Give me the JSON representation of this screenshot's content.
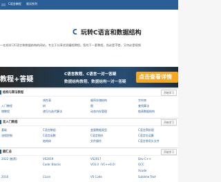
{
  "nav": {
    "items": [
      "",
      "C语言教程",
      "就试系列"
    ]
  },
  "hero": {
    "title": "玩转C语言和数据结构",
    "description": "一在线学习C语言和数据结构的网站，专注于分享优质编程教程。您的下一套教程，尚必是不错，又何必是视频"
  },
  "banner": {
    "left": "教程+答疑",
    "line1": "C语言教程、C语言一对一答疑",
    "line2": "数据结构教程、数据结构一对一答疑",
    "cta": "点击查看详情"
  },
  "sections": [
    {
      "title": "结构与算法教程",
      "more": "开始学习",
      "cols": [
        [
          "",
          "入门教程",
          "储教程"
        ],
        [
          "线性表",
          "树",
          "递归与迭代算法"
        ],
        [
          "顺序存储结构",
          "图",
          "动态内存管理"
        ],
        [
          "字符串",
          "查找算法",
          "链表数据结构"
        ]
      ]
    },
    {
      "title": "言入门教程",
      "more": "开始学习",
      "cols": [
        [
          "基础",
          "流程控制",
          ""
        ],
        [
          "C语言数组",
          "C语言函数",
          "结构体"
        ],
        [
          "变量数据类型",
          "C语言指针",
          "文件操作"
        ],
        [
          "C语言预处理",
          "C语言位运算",
          "C语言常用头文件"
        ]
      ]
    },
    {
      "title": "器汇总",
      "more": "开始学习",
      "cols": [
        [
          "2022 (推荐)",
          "",
          "2010"
        ],
        [
          "VS2019",
          "Code::Blocks",
          "CLion"
        ],
        [
          "VS2017",
          "VC6.0（VC++6.0）",
          "VS Code"
        ],
        [
          "Dev C++",
          "GCC",
          "Xcode",
          "Sublime Text"
        ]
      ]
    }
  ]
}
